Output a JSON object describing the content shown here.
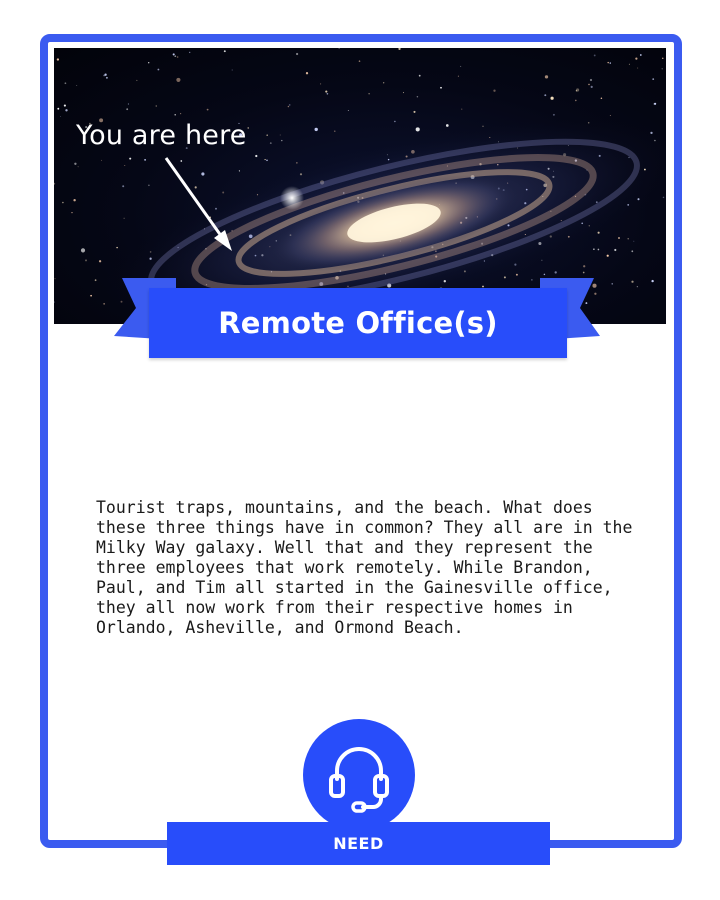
{
  "hero": {
    "caption": "You are here",
    "image_subject": "spiral galaxy"
  },
  "banner": {
    "title": "Remote Office(s)"
  },
  "card": {
    "description": "Tourist traps, mountains, and the beach. What does these three things have in common? They all are in the Milky Way galaxy. Well that and they represent the three employees that work remotely. While Brandon, Paul, and Tim all started in the Gainesville office, they all now work from their respective homes in Orlando, Asheville, and Ormond Beach."
  },
  "footer": {
    "icon": "headset-icon",
    "label": "NEED"
  },
  "colors": {
    "accent": "#284dfa",
    "border": "#3b5bf0",
    "text": "#1a1a1a"
  }
}
